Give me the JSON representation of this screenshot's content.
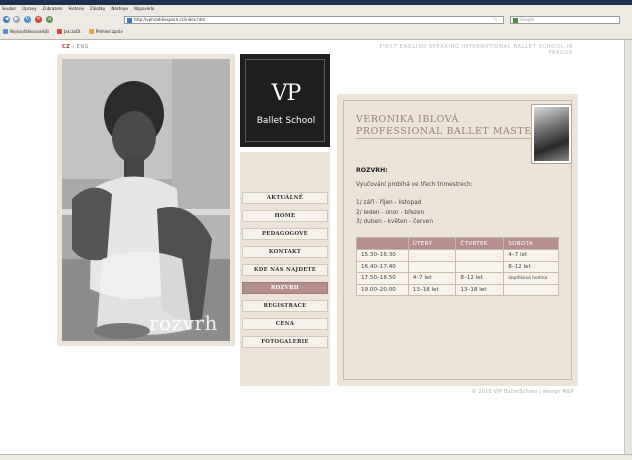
{
  "browser": {
    "menu": [
      "Soubor",
      "Úpravy",
      "Zobrazení",
      "Historie",
      "Záložky",
      "Nástroje",
      "Nápověda"
    ],
    "url": "http://vphraddiespace.cz/index.htm",
    "search_placeholder": "Google",
    "bookmarks": [
      "Nejnavštěvovanější",
      "Jak začít",
      "Přehled zpráv"
    ]
  },
  "page": {
    "lang_cz": "CZ",
    "lang_sep": " / ",
    "lang_en": "ENG",
    "tagline": "FIRST ENGLISH SPEAKING INTERNATIONAL BALLET SCHOOL IN PRAGUE",
    "photo_caption": "rozvrh",
    "logo_mark": "VP",
    "logo_name": "Ballet School",
    "nav": [
      {
        "label": "AKTUÁLNĚ",
        "active": false
      },
      {
        "label": "HOME",
        "active": false
      },
      {
        "label": "PEDAGOGOVÉ",
        "active": false
      },
      {
        "label": "KONTAKT",
        "active": false
      },
      {
        "label": "KDE NÁS NAJDETE",
        "active": false
      },
      {
        "label": "ROZVRH",
        "active": true
      },
      {
        "label": "REGISTRACE",
        "active": false
      },
      {
        "label": "CENA",
        "active": false
      },
      {
        "label": "FOTOGALERIE",
        "active": false
      }
    ],
    "content": {
      "title_line1": "VERONIKA IBLOVÁ",
      "title_line2": "PROFESSIONAL BALLET MASTER",
      "heading": "ROZVRH:",
      "intro": "Vyučování probíhá ve třech trimestrech:",
      "terms": [
        "1/ září - říjen - listopad",
        "2/ leden - únor - březen",
        "3/ duben - květen - červen"
      ],
      "table": {
        "headers": [
          "",
          "ÚTERÝ",
          "ČTVRTEK",
          "SOBOTA"
        ],
        "rows": [
          [
            "15.30–16.30",
            "",
            "",
            "4–7 let"
          ],
          [
            "16.40–17.40",
            "",
            "",
            "8–12 let"
          ],
          [
            "17.50–18.50",
            "4–7 let",
            "8–12 let",
            "doplňková hodina"
          ],
          [
            "19.00–20.00",
            "13–18 let",
            "13–18 let",
            ""
          ]
        ]
      }
    },
    "footer": "© 2010 VIP BalletSchool / design M&P"
  },
  "colors": {
    "accent": "#b58f8d",
    "panel": "#ece4d8",
    "title": "#9b7d72",
    "lang_active": "#9f3a34"
  }
}
